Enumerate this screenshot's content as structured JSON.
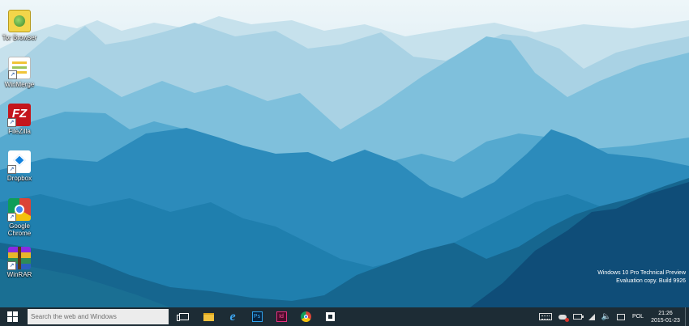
{
  "desktop": {
    "icons": [
      {
        "label": "Tor Browser",
        "icon": "tor-browser-icon"
      },
      {
        "label": "WinMerge",
        "icon": "winmerge-icon"
      },
      {
        "label": "FileZilla",
        "icon": "filezilla-icon",
        "glyph": "FZ"
      },
      {
        "label": "Dropbox",
        "icon": "dropbox-icon"
      },
      {
        "label": "Google Chrome",
        "icon": "chrome-icon"
      },
      {
        "label": "WinRAR",
        "icon": "winrar-icon"
      }
    ],
    "shortcut_arrow": "↗"
  },
  "watermark": {
    "line1": "Windows 10 Pro Technical Preview",
    "line2": "Evaluation copy. Build 9926"
  },
  "taskbar": {
    "search_placeholder": "Search the web and Windows",
    "pinned": [
      {
        "name": "task-view-icon"
      },
      {
        "name": "file-explorer-icon"
      },
      {
        "name": "internet-explorer-icon",
        "glyph": "e"
      },
      {
        "name": "photoshop-icon",
        "glyph": "Ps"
      },
      {
        "name": "indesign-icon",
        "glyph": "Id"
      },
      {
        "name": "chrome-icon"
      },
      {
        "name": "store-icon"
      }
    ],
    "tray": {
      "volume_glyph": "🔈",
      "language": "POL",
      "time": "21:26",
      "date": "2015-01-23"
    }
  },
  "colors": {
    "taskbar_bg": "#1d2c35",
    "search_bg": "#ececec",
    "sky": "#eef6f9",
    "mountain_far": "#a9d2e4",
    "mountain_mid": "#5fb0d3",
    "mountain_near": "#1f7fae",
    "mountain_front": "#0f4d78"
  }
}
